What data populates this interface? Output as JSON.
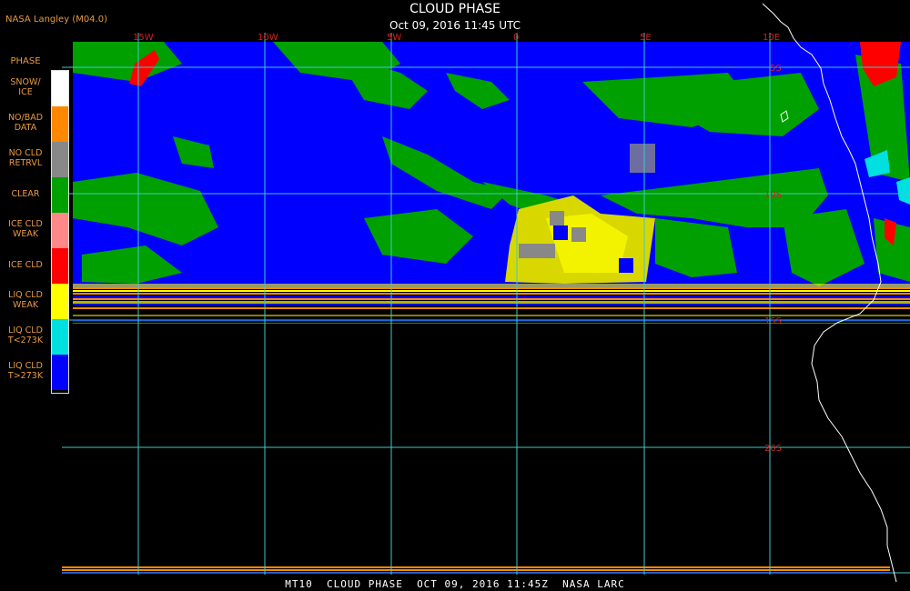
{
  "header": {
    "title": "CLOUD PHASE",
    "subtitle": "Oct 09, 2016 11:45 UTC",
    "source": "NASA Langley (M04.0)"
  },
  "footer": {
    "caption": "MT10  CLOUD PHASE  OCT 09, 2016 11:45Z  NASA LARC"
  },
  "legend": {
    "title": "PHASE",
    "items": [
      {
        "label_line1": "SNOW/",
        "label_line2": "ICE",
        "color": "#ffffff"
      },
      {
        "label_line1": "NO/BAD",
        "label_line2": "DATA",
        "color": "#ff8800"
      },
      {
        "label_line1": "NO CLD",
        "label_line2": "RETRVL",
        "color": "#888888"
      },
      {
        "label_line1": "CLEAR",
        "label_line2": "",
        "color": "#00a000"
      },
      {
        "label_line1": "ICE CLD",
        "label_line2": "WEAK",
        "color": "#ff8888"
      },
      {
        "label_line1": "ICE CLD",
        "label_line2": "",
        "color": "#ff0000"
      },
      {
        "label_line1": "LIQ CLD",
        "label_line2": "WEAK",
        "color": "#ffff00"
      },
      {
        "label_line1": "LIQ CLD",
        "label_line2": "T<273K",
        "color": "#00e0e0"
      },
      {
        "label_line1": "LIQ CLD",
        "label_line2": "T>273K",
        "color": "#0000ff"
      }
    ]
  },
  "map": {
    "longitude_labels": [
      "15W",
      "10W",
      "5W",
      "0",
      "5E",
      "10E"
    ],
    "latitude_labels": [
      "5S",
      "10S",
      "15S",
      "20S"
    ],
    "colors": {
      "background": "#000000",
      "grid": "#40c8c8",
      "coastline": "#ffffff",
      "label": "#d42020"
    }
  }
}
